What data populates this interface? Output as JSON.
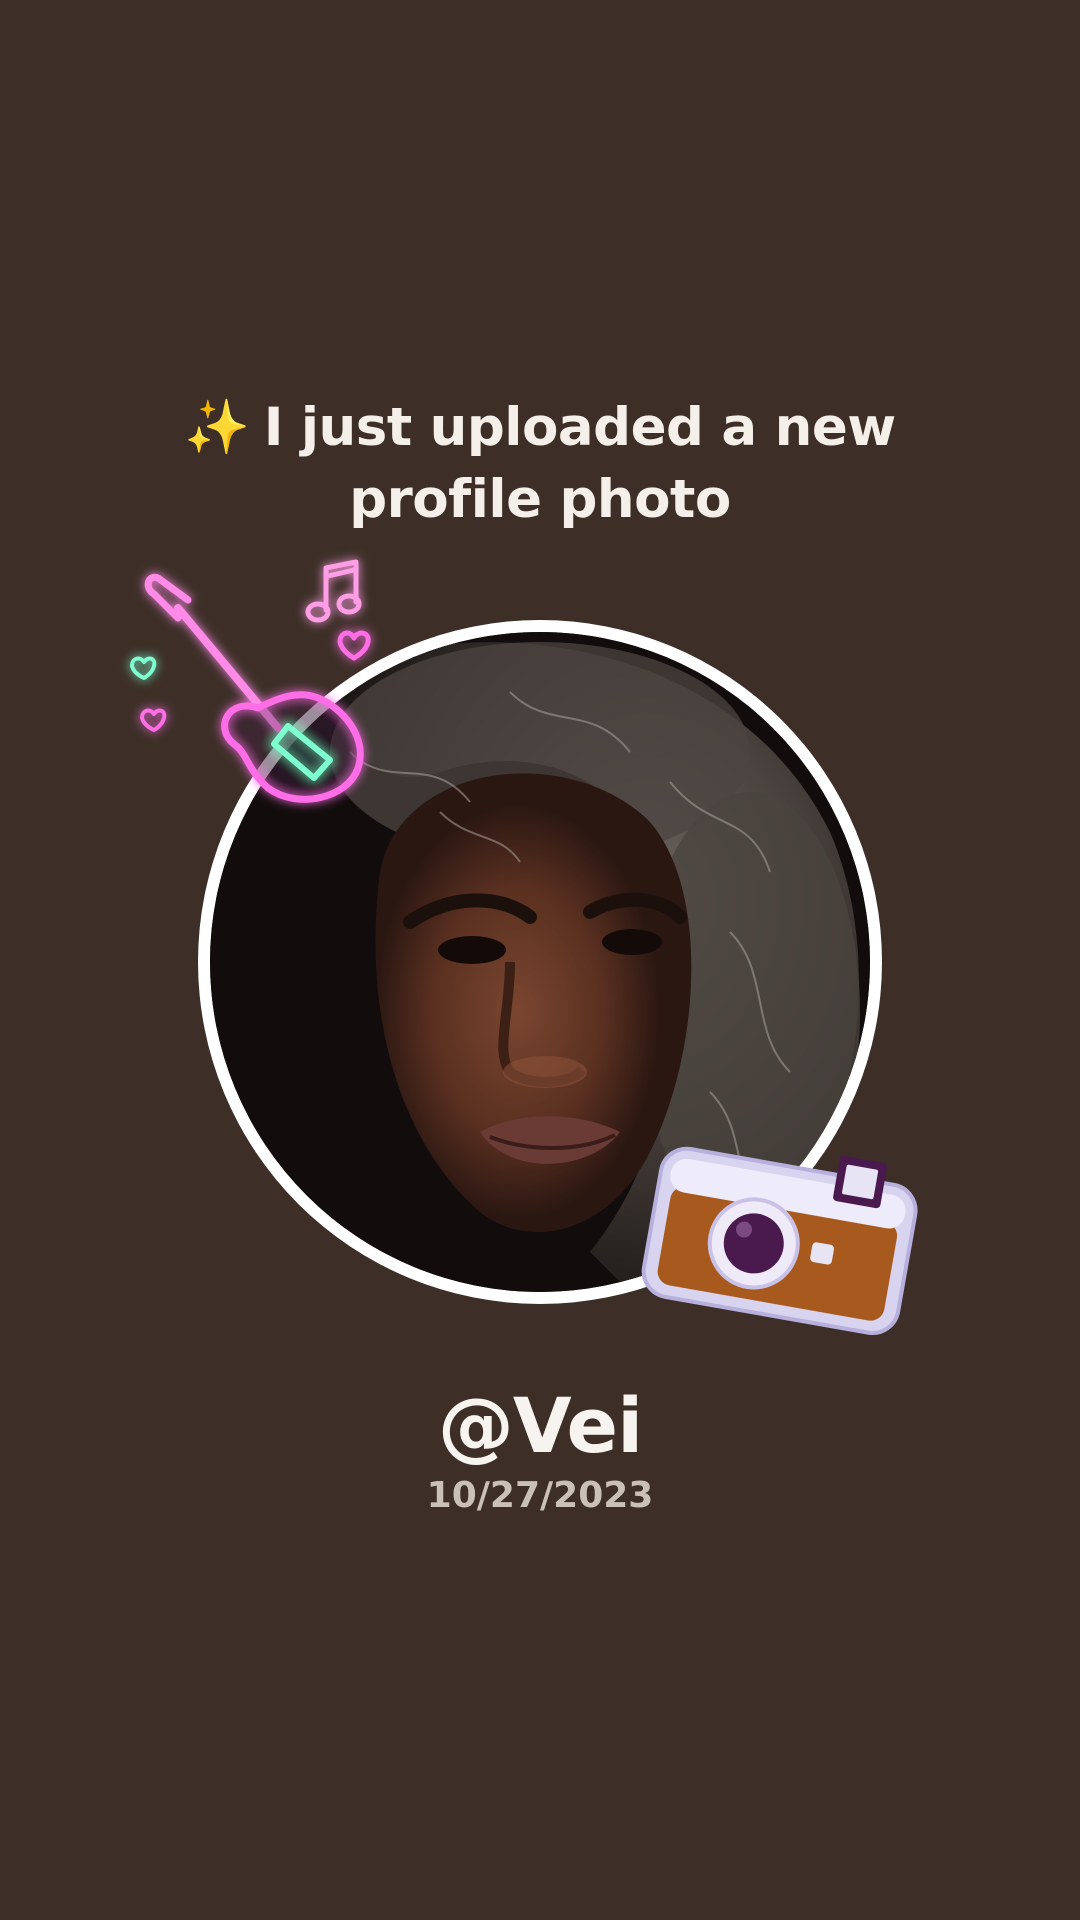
{
  "headline": {
    "sparkle_icon": "✨",
    "line1": "I just uploaded a new",
    "line2": "profile photo"
  },
  "profile": {
    "username": "@Vei",
    "date": "10/27/2023"
  },
  "stickers": {
    "top_left": "neon-guitar-sticker",
    "bottom_right": "camera-sticker"
  },
  "colors": {
    "background": "#3d2f28",
    "text": "#f4efe9",
    "subtext": "#c9c0b8",
    "neon_pink": "#ff6ee7",
    "neon_mint": "#7dffd0",
    "camera_body": "#a85a1e",
    "camera_lens": "#4a1a4e"
  }
}
